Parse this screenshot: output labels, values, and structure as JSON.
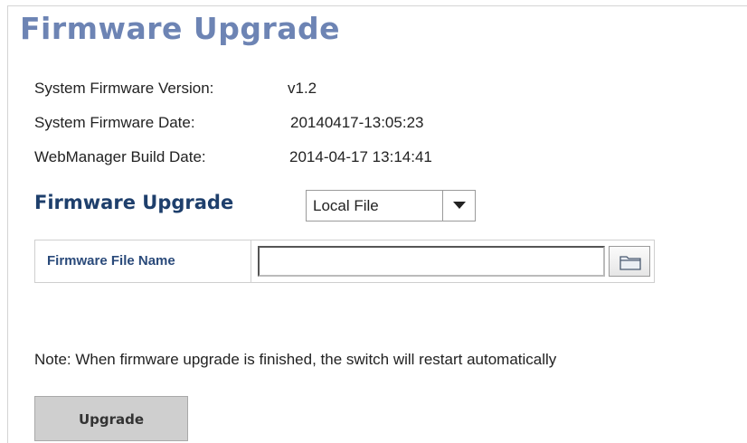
{
  "page": {
    "title": "Firmware Upgrade"
  },
  "info": {
    "version_label": "System Firmware Version:",
    "version_value": "v1.2",
    "date_label": "System Firmware Date:",
    "date_value": "20140417-13:05:23",
    "build_label": "WebManager Build Date:",
    "build_value": "2014-04-17 13:14:41"
  },
  "upgrade": {
    "section_title": "Firmware Upgrade",
    "source_selected": "Local File",
    "source_arrow_icon": "chevron-down-icon",
    "file_label": "Firmware File Name",
    "file_value": "",
    "browse_icon": "folder-icon",
    "note": "Note: When firmware upgrade is finished, the switch will restart automatically",
    "button_label": "Upgrade"
  },
  "colors": {
    "title": "#6d84b4",
    "section_title": "#1e3f6c",
    "file_label": "#2a4a7a",
    "button_bg": "#cfcfcf"
  }
}
